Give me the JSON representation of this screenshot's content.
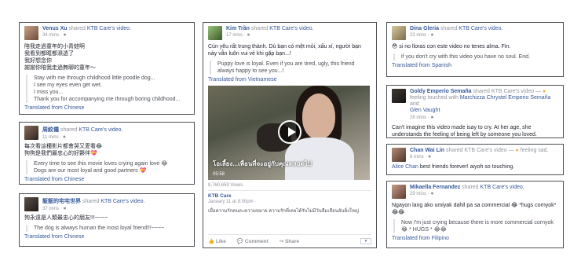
{
  "common": {
    "shared_text": "shared",
    "video_link": "KTB Care's video.",
    "video_link_short": "KTB Care's video",
    "translated_from": "Translated from"
  },
  "posts": {
    "venus": {
      "name": "Venus Xu",
      "time": "34 mins ·",
      "text": "陪我走過童年的小青蛙啊\n我看到都眶都濕透了\n我好想念你\n謝謝你陪我走過無聊的童年～",
      "quote": "Stay with me through childhood little poodle dog...\nI see my eyes even get wet.\nI miss you...\nThank you for accompanying me through boring childhood...",
      "lang": "Chinese"
    },
    "zhou": {
      "name": "周紋儀",
      "time": "11 mins ·",
      "text": "每次看這種影片都會哭又愛看😂\n狗狗是我們最忠心的好夥伴💝",
      "quote": "Every time to see this movie loves crying again love 😂\nDogs are our most loyal and good partners 💝",
      "lang": "Chinese"
    },
    "yusuo": {
      "name": "飯飯的宅宅世界",
      "time": "37 mins ·",
      "text": "狗永遠是人類最忠心的朋友!!!~~~~",
      "quote": "The dog is always human the most loyal friend!!!~~~~",
      "lang": "Chinese"
    },
    "kim": {
      "name": "Kim Trần",
      "time": "17 mins ·",
      "text": "Cún yêu rất trung thành. Dù bạn có mệt mỏi, xấu xí, người bạn này vẫn luôn vui vẻ khi gặp bạn...!",
      "quote": "Puppy love is loyal. Even if you are tired, ugly, this friend always happy to see you...!",
      "lang": "Vietnamese",
      "video_caption": "โอเลี้ยง...เพื่อนที่จะอยู่กับคุณตลอดไป",
      "video_duration": "05:58",
      "views": "8,760,659 Views",
      "page_name": "KTB Care",
      "page_date": "January 11 at 8:00pm ·",
      "page_text": "เมื่อความรักคนละความหมาย ความรักที่เคยได้รับไม่มีวันลืมเลือนอันยิ่งใหญ่",
      "like": "Like",
      "comment": "Comment",
      "share": "Share"
    },
    "dina": {
      "name": "Dina Gleria",
      "time": "23 mins ·",
      "text": "😳 si no lloras con este video no tenes alma. Fin.",
      "quote": "if you don't cry with this video you have no soul. End.",
      "lang": "Spanish"
    },
    "goldy": {
      "name": "Goldy Emperio Semaña",
      "action": "shared KTB Care's video —",
      "feeling": "feeling touched with",
      "tag1": "Marchizza Chrystel Emperio Semaña",
      "and_text": "and",
      "tag2": "Glen Vaught",
      "time": "26 mins ·",
      "text": "Can't imagine this video made isay to cry. At her age, she understands the feeling of being left by someone you loved."
    },
    "chan": {
      "name": "Chan Wai Lin",
      "action": "shared KTB Care's video —",
      "feeling": "feeling sad.",
      "time": "6 mins ·",
      "tag": "Alice Chan",
      "text": "best friends forever! aiyoh so touching."
    },
    "mikaella": {
      "name": "Mikaella Fernandez",
      "time": "29 mins ·",
      "text": "Ngayon lang ako umiyak dahil pa sa commercial 😂 *hugs cornyok* 😂😂",
      "quote": "Now I'm just crying because there is more commercial cornyok 😂 * HUGS * 😂😂",
      "lang": "Filipino"
    }
  },
  "colors": {
    "link": "#365899",
    "muted": "#90949c",
    "border": "#4b4f56"
  }
}
